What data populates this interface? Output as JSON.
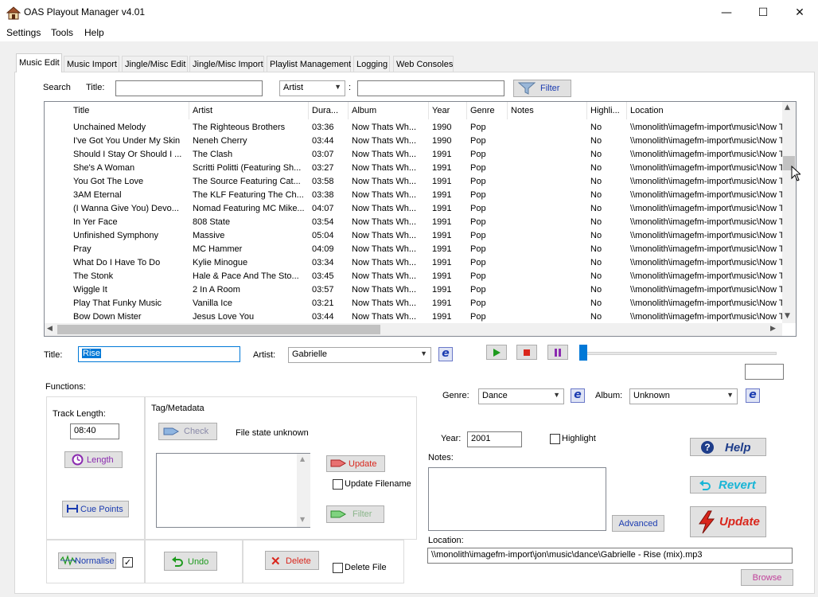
{
  "window": {
    "title": "OAS Playout Manager v4.01",
    "minimize": "—",
    "maximize": "☐",
    "close": "✕"
  },
  "menu": [
    "Settings",
    "Tools",
    "Help"
  ],
  "tabs": [
    "Music Edit",
    "Music Import",
    "Jingle/Misc Edit",
    "Jingle/Misc Import",
    "Playlist Management",
    "Logging",
    "Web Consoles"
  ],
  "search": {
    "label": "Search",
    "title_label": "Title:",
    "title_value": "",
    "field_select": "Artist",
    "colon": ":",
    "field_value": "",
    "filter_button": "Filter"
  },
  "grid": {
    "columns": [
      "Title",
      "Artist",
      "Dura...",
      "Album",
      "Year",
      "Genre",
      "Notes",
      "Highli...",
      "Location"
    ],
    "rows": [
      [
        "Unchained Melody",
        "The Righteous Brothers",
        "03:36",
        "Now Thats Wh...",
        "1990",
        "Pop",
        "",
        "No",
        "\\\\monolith\\imagefm-import\\music\\Now T"
      ],
      [
        "I've Got You Under My Skin",
        "Neneh Cherry",
        "03:44",
        "Now Thats Wh...",
        "1990",
        "Pop",
        "",
        "No",
        "\\\\monolith\\imagefm-import\\music\\Now T"
      ],
      [
        "Should I Stay Or Should I ...",
        "The Clash",
        "03:07",
        "Now Thats Wh...",
        "1991",
        "Pop",
        "",
        "No",
        "\\\\monolith\\imagefm-import\\music\\Now T"
      ],
      [
        "She's A Woman",
        "Scritti Politti (Featuring Sh...",
        "03:27",
        "Now Thats Wh...",
        "1991",
        "Pop",
        "",
        "No",
        "\\\\monolith\\imagefm-import\\music\\Now T"
      ],
      [
        "You Got The Love",
        "The Source Featuring Cat...",
        "03:58",
        "Now Thats Wh...",
        "1991",
        "Pop",
        "",
        "No",
        "\\\\monolith\\imagefm-import\\music\\Now T"
      ],
      [
        "3AM Eternal",
        "The KLF Featuring The Ch...",
        "03:38",
        "Now Thats Wh...",
        "1991",
        "Pop",
        "",
        "No",
        "\\\\monolith\\imagefm-import\\music\\Now T"
      ],
      [
        "(I Wanna Give You) Devo...",
        "Nomad Featuring MC Mike...",
        "04:07",
        "Now Thats Wh...",
        "1991",
        "Pop",
        "",
        "No",
        "\\\\monolith\\imagefm-import\\music\\Now T"
      ],
      [
        "In Yer Face",
        "808 State",
        "03:54",
        "Now Thats Wh...",
        "1991",
        "Pop",
        "",
        "No",
        "\\\\monolith\\imagefm-import\\music\\Now T"
      ],
      [
        "Unfinished Symphony",
        "Massive",
        "05:04",
        "Now Thats Wh...",
        "1991",
        "Pop",
        "",
        "No",
        "\\\\monolith\\imagefm-import\\music\\Now T"
      ],
      [
        "Pray",
        "MC Hammer",
        "04:09",
        "Now Thats Wh...",
        "1991",
        "Pop",
        "",
        "No",
        "\\\\monolith\\imagefm-import\\music\\Now T"
      ],
      [
        "What Do I Have To Do",
        "Kylie Minogue",
        "03:34",
        "Now Thats Wh...",
        "1991",
        "Pop",
        "",
        "No",
        "\\\\monolith\\imagefm-import\\music\\Now T"
      ],
      [
        "The Stonk",
        "Hale & Pace And The Sto...",
        "03:45",
        "Now Thats Wh...",
        "1991",
        "Pop",
        "",
        "No",
        "\\\\monolith\\imagefm-import\\music\\Now T"
      ],
      [
        "Wiggle It",
        "2 In A Room",
        "03:57",
        "Now Thats Wh...",
        "1991",
        "Pop",
        "",
        "No",
        "\\\\monolith\\imagefm-import\\music\\Now T"
      ],
      [
        "Play That Funky Music",
        "Vanilla Ice",
        "03:21",
        "Now Thats Wh...",
        "1991",
        "Pop",
        "",
        "No",
        "\\\\monolith\\imagefm-import\\music\\Now T"
      ],
      [
        "Bow Down Mister",
        "Jesus Love You",
        "03:44",
        "Now Thats Wh...",
        "1991",
        "Pop",
        "",
        "No",
        "\\\\monolith\\imagefm-import\\music\\Now T"
      ]
    ]
  },
  "editor": {
    "title_label": "Title:",
    "title_value": "Rise",
    "artist_label": "Artist:",
    "artist_value": "Gabrielle",
    "genre_label": "Genre:",
    "genre_value": "Dance",
    "album_label": "Album:",
    "album_value": "Unknown",
    "year_label": "Year:",
    "year_value": "2001",
    "highlight_label": "Highlight",
    "notes_label": "Notes:",
    "notes_value": "",
    "advanced_button": "Advanced",
    "location_label": "Location:",
    "location_value": "\\\\monolith\\imagefm-import\\jon\\music\\dance\\Gabrielle - Rise (mix).mp3",
    "browse_button": "Browse",
    "help_button": "Help",
    "revert_button": "Revert",
    "update_button": "Update",
    "e_glyph": "e",
    "position_value": ""
  },
  "functions": {
    "label": "Functions:",
    "track_length_label": "Track Length:",
    "track_length_value": "08:40",
    "length_button": "Length",
    "cue_points_button": "Cue Points",
    "normalise_button": "Normalise",
    "tag_label": "Tag/Metadata",
    "check_button": "Check",
    "file_state": "File state unknown",
    "tag_text": "",
    "update_button": "Update",
    "update_filename_label": "Update Filename",
    "filter_button": "Filter",
    "undo_button": "Undo",
    "delete_button": "Delete",
    "delete_file_label": "Delete File"
  },
  "player": {
    "seek_fraction": 0.0
  },
  "colors": {
    "accent_blue": "#0078d7",
    "update_red": "#d9261c",
    "revert_cyan": "#19b5d6",
    "help_navy": "#1e3d8a",
    "play_green": "#1d9a1d",
    "pause_purple": "#8b2bb0"
  }
}
